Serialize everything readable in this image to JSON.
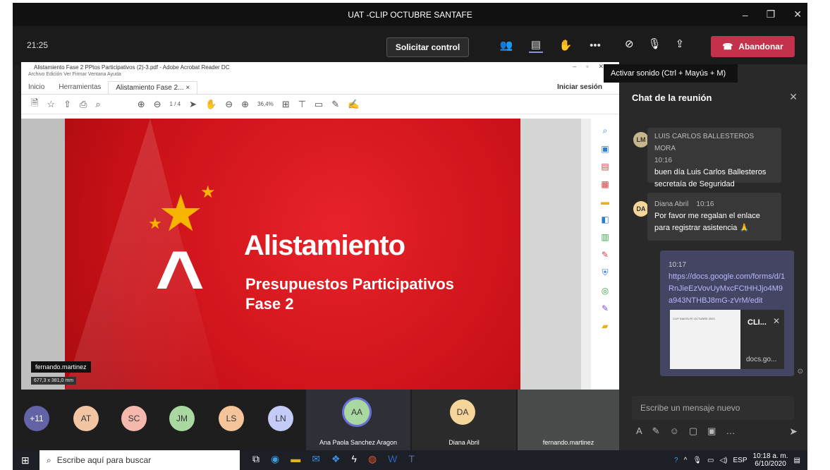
{
  "window": {
    "title": "UAT -CLIP OCTUBRE SANTAFE"
  },
  "toolbar": {
    "time": "21:25",
    "request_control": "Solicitar control",
    "leave": "Abandonar",
    "more": "•••"
  },
  "tooltip": "Activar sonido (Ctrl + Mayús + M)",
  "acrobat": {
    "title": "Alistamiento Fase 2 PPtos Participativos (2)-3.pdf - Adobe Acrobat Reader DC",
    "menu": "Archivo  Edición  Ver  Firmar  Ventana  Ayuda",
    "tabs": [
      "Inicio",
      "Herramientas",
      "Alistamiento Fase 2... ×"
    ],
    "signin": "Iniciar sesión",
    "page_indicator": "1 / 4",
    "zoom": "36,4%"
  },
  "slide": {
    "title": "Alistamiento",
    "subtitle": "Presupuestos Participativos",
    "phase": "Fase 2"
  },
  "presenter": {
    "name": "fernando.martinez",
    "size": "677,3 x 381,0 mm"
  },
  "chat": {
    "header": "Chat de la reunión",
    "messages": [
      {
        "initials": "LM",
        "author": "LUIS CARLOS BALLESTEROS MORA",
        "time": "10:16",
        "text": "buen día Luis Carlos Ballesteros secretaía de Seguridad"
      },
      {
        "initials": "DA",
        "author": "Diana Abril",
        "time": "10:16",
        "text": "Por favor me regalan el enlace para registrar asistencia 🙏"
      }
    ],
    "self": {
      "time": "10:17",
      "link": "https://docs.google.com/forms/d/1RnJieEzVovUyMxcFCtHHJjo4M9a943NTHBJ8mG-zVrM/edit",
      "card_title": "CLI...",
      "card_domain": "docs.go...",
      "card_thumb_title": "CLIP SANTA FE OCTUBRE 2020"
    },
    "compose_placeholder": "Escribe un mensaje nuevo"
  },
  "participants": [
    {
      "initials": "+11",
      "color": "#6264a7"
    },
    {
      "initials": "AT",
      "color": "#f3c6a3"
    },
    {
      "initials": "SC",
      "color": "#f4b8ad"
    },
    {
      "initials": "JM",
      "color": "#a9d9a0"
    },
    {
      "initials": "LS",
      "color": "#f6c49a"
    },
    {
      "initials": "LN",
      "color": "#c5cbf7"
    }
  ],
  "video_tiles": [
    {
      "initials": "AA",
      "name": "Ana Paola Sanchez Aragon",
      "color": "#a9d9a0"
    },
    {
      "initials": "DA",
      "name": "Diana Abril",
      "color": "#f5d59a"
    },
    {
      "name": "fernando.martinez"
    }
  ],
  "taskbar": {
    "search_placeholder": "Escribe aquí para buscar",
    "lang": "ESP",
    "time": "10:18 a. m.",
    "date": "6/10/2020"
  }
}
